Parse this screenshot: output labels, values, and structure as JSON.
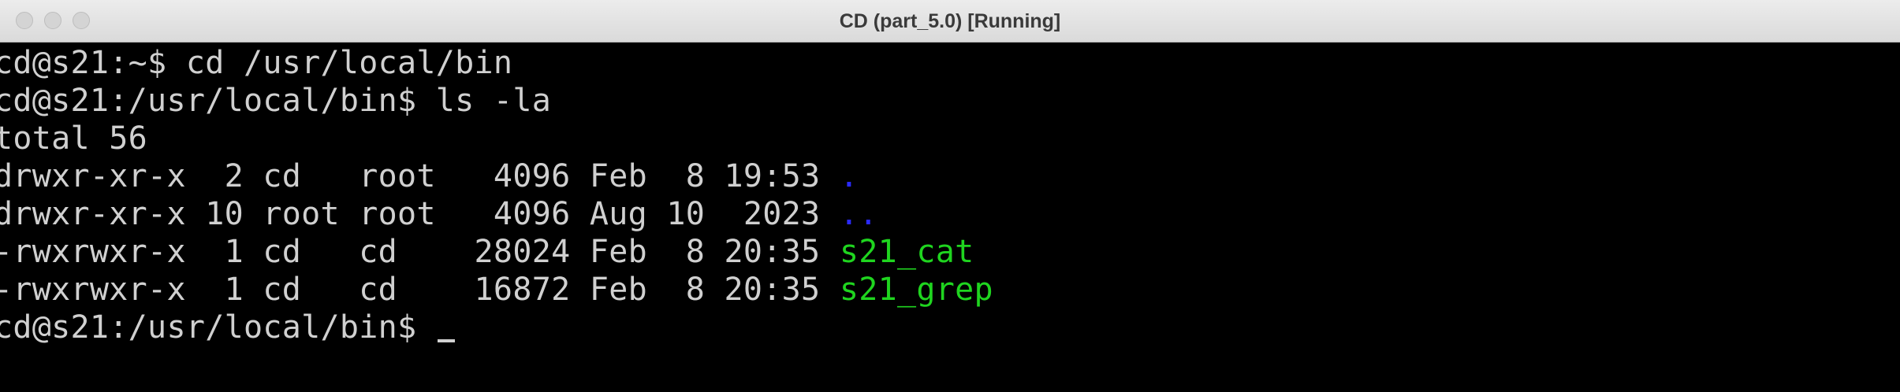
{
  "window": {
    "title": "CD (part_5.0) [Running]"
  },
  "terminal": {
    "lines": [
      {
        "text": "cd@s21:~$ cd /usr/local/bin"
      },
      {
        "text": "cd@s21:/usr/local/bin$ ls -la"
      },
      {
        "text": "total 56"
      },
      {
        "text": "drwxr-xr-x  2 cd   root   4096 Feb  8 19:53 ",
        "name": "."
      },
      {
        "text": "drwxr-xr-x 10 root root   4096 Aug 10  2023 ",
        "name": ".."
      },
      {
        "text": "-rwxrwxr-x  1 cd   cd    28024 Feb  8 20:35 ",
        "name": "s21_cat"
      },
      {
        "text": "-rwxrwxr-x  1 cd   cd    16872 Feb  8 20:35 ",
        "name": "s21_grep"
      },
      {
        "text": "cd@s21:/usr/local/bin$ "
      }
    ]
  },
  "colors": {
    "background": "#000000",
    "text": "#d0d0d0",
    "directory": "#2a2aff",
    "executable": "#1fd51f"
  }
}
